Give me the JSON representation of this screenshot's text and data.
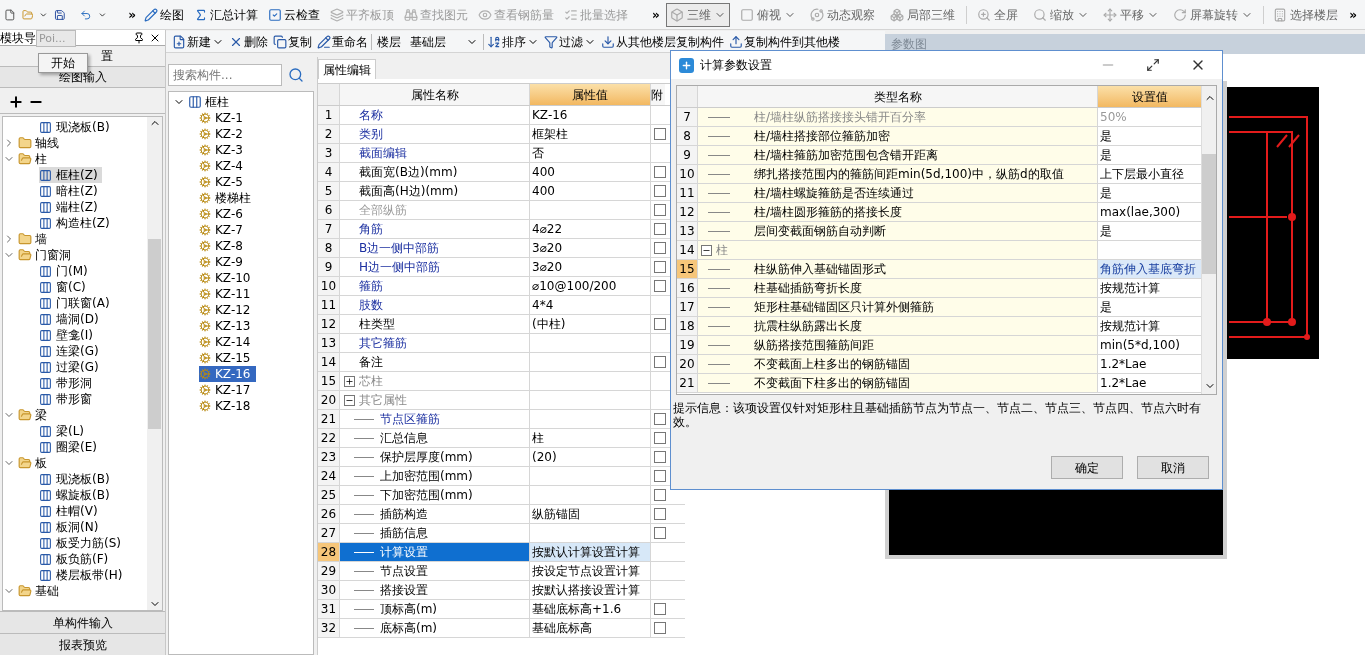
{
  "toolbar": {
    "overflow_marks": [
      "»",
      "»",
      "»"
    ],
    "left_items": [
      {
        "label": "绘图",
        "disabled": false
      },
      {
        "label": "汇总计算",
        "disabled": false
      },
      {
        "label": "云检查",
        "disabled": false
      },
      {
        "label": "平齐板顶",
        "disabled": true
      },
      {
        "label": "查找图元",
        "disabled": true
      },
      {
        "label": "查看钢筋量",
        "disabled": true
      },
      {
        "label": "批量选择",
        "disabled": true
      }
    ],
    "right_items": [
      {
        "label": "三维",
        "dropdown": true,
        "selected": true
      },
      {
        "label": "俯视",
        "dropdown": true,
        "selected": false
      },
      {
        "label": "动态观察",
        "dropdown": false,
        "selected": false
      },
      {
        "label": "局部三维",
        "dropdown": false,
        "selected": false
      },
      {
        "label": "全屏",
        "dropdown": false,
        "selected": false
      },
      {
        "label": "缩放",
        "dropdown": true,
        "selected": false
      },
      {
        "label": "平移",
        "dropdown": true,
        "selected": false
      },
      {
        "label": "屏幕旋转",
        "dropdown": true,
        "selected": false
      },
      {
        "label": "选择楼层",
        "dropdown": false,
        "selected": false
      }
    ]
  },
  "left_panel": {
    "title": "模块导",
    "popup_tab": "Poi...",
    "popup_menu_item": "开始",
    "top_sections": [
      "置",
      "绘图输入"
    ],
    "bottom_sections": [
      "单构件输入",
      "报表预览"
    ]
  },
  "module_tree": {
    "continued_items": [
      {
        "label": "现浇板(B)",
        "selected": false
      }
    ],
    "folders": [
      {
        "label": "轴线",
        "expanded": false
      },
      {
        "label": "柱",
        "expanded": true,
        "children": [
          {
            "label": "框柱(Z)",
            "selected": true
          },
          {
            "label": "暗柱(Z)",
            "selected": false
          },
          {
            "label": "端柱(Z)",
            "selected": false
          },
          {
            "label": "构造柱(Z)",
            "selected": false
          }
        ]
      },
      {
        "label": "墙",
        "expanded": false
      },
      {
        "label": "门窗洞",
        "expanded": true,
        "children": [
          {
            "label": "门(M)",
            "selected": false
          },
          {
            "label": "窗(C)",
            "selected": false
          },
          {
            "label": "门联窗(A)",
            "selected": false
          },
          {
            "label": "墙洞(D)",
            "selected": false
          },
          {
            "label": "壁龛(I)",
            "selected": false
          },
          {
            "label": "连梁(G)",
            "selected": false
          },
          {
            "label": "过梁(G)",
            "selected": false
          },
          {
            "label": "带形洞",
            "selected": false
          },
          {
            "label": "带形窗",
            "selected": false
          }
        ]
      },
      {
        "label": "梁",
        "expanded": true,
        "children": [
          {
            "label": "梁(L)",
            "selected": false
          },
          {
            "label": "圈梁(E)",
            "selected": false
          }
        ]
      },
      {
        "label": "板",
        "expanded": true,
        "children": [
          {
            "label": "现浇板(B)",
            "selected": false
          },
          {
            "label": "螺旋板(B)",
            "selected": false
          },
          {
            "label": "柱帽(V)",
            "selected": false
          },
          {
            "label": "板洞(N)",
            "selected": false
          },
          {
            "label": "板受力筋(S)",
            "selected": false
          },
          {
            "label": "板负筋(F)",
            "selected": false
          },
          {
            "label": "楼层板带(H)",
            "selected": false
          }
        ]
      },
      {
        "label": "基础",
        "expanded": true
      }
    ]
  },
  "component_toolbar": {
    "items_before": [
      {
        "label": "新建",
        "dropdown": true
      },
      {
        "label": "删除",
        "dropdown": false
      },
      {
        "label": "复制",
        "dropdown": false
      },
      {
        "label": "重命名",
        "dropdown": false
      }
    ],
    "floor_label": "楼层",
    "floor_value": "基础层",
    "items_after": [
      {
        "label": "排序",
        "dropdown": true
      },
      {
        "label": "过滤",
        "dropdown": true
      },
      {
        "label": "从其他楼层复制构件",
        "dropdown": false
      },
      {
        "label": "复制构件到其他楼",
        "dropdown": false
      }
    ]
  },
  "search": {
    "placeholder": "搜索构件..."
  },
  "component_tree": {
    "label": "框柱",
    "expanded": true,
    "children": [
      {
        "label": "KZ-1",
        "selected": false
      },
      {
        "label": "KZ-2",
        "selected": false
      },
      {
        "label": "KZ-3",
        "selected": false
      },
      {
        "label": "KZ-4",
        "selected": false
      },
      {
        "label": "KZ-5",
        "selected": false
      },
      {
        "label": "楼梯柱",
        "selected": false
      },
      {
        "label": "KZ-6",
        "selected": false
      },
      {
        "label": "KZ-7",
        "selected": false
      },
      {
        "label": "KZ-8",
        "selected": false
      },
      {
        "label": "KZ-9",
        "selected": false
      },
      {
        "label": "KZ-10",
        "selected": false
      },
      {
        "label": "KZ-11",
        "selected": false
      },
      {
        "label": "KZ-12",
        "selected": false
      },
      {
        "label": "KZ-13",
        "selected": false
      },
      {
        "label": "KZ-14",
        "selected": false
      },
      {
        "label": "KZ-15",
        "selected": false
      },
      {
        "label": "KZ-16",
        "selected": true
      },
      {
        "label": "KZ-17",
        "selected": false
      },
      {
        "label": "KZ-18",
        "selected": false
      }
    ]
  },
  "property_panel": {
    "tab": "属性编辑",
    "columns": [
      "属性名称",
      "属性值",
      "附"
    ],
    "rows": [
      {
        "number": "1",
        "name": "名称",
        "value": "KZ-16",
        "kind": "public",
        "selected": false
      },
      {
        "number": "2",
        "name": "类别",
        "value": "框架柱",
        "kind": "public",
        "selected": false,
        "checked": false
      },
      {
        "number": "3",
        "name": "截面编辑",
        "value": "否",
        "kind": "public",
        "selected": false
      },
      {
        "number": "4",
        "name": "截面宽(B边)(mm)",
        "value": "400",
        "kind": "private",
        "selected": false,
        "checked": false
      },
      {
        "number": "5",
        "name": "截面高(H边)(mm)",
        "value": "400",
        "kind": "private",
        "selected": false,
        "checked": false
      },
      {
        "number": "6",
        "name": "全部纵筋",
        "kind": "inactive",
        "selected": false,
        "checked": false
      },
      {
        "number": "7",
        "name": "角筋",
        "value": "4⌀22",
        "kind": "public",
        "selected": false,
        "checked": false
      },
      {
        "number": "8",
        "name": "B边一侧中部筋",
        "value": "3⌀20",
        "kind": "public",
        "selected": false,
        "checked": false
      },
      {
        "number": "9",
        "name": "H边一侧中部筋",
        "value": "3⌀20",
        "kind": "public",
        "selected": false,
        "checked": false
      },
      {
        "number": "10",
        "name": "箍筋",
        "value": "⌀10@100/200",
        "kind": "public",
        "selected": false,
        "checked": false
      },
      {
        "number": "11",
        "name": "肢数",
        "value": "4*4",
        "kind": "public",
        "selected": false
      },
      {
        "number": "12",
        "name": "柱类型",
        "value": "(中柱)",
        "kind": "private",
        "selected": false,
        "checked": false
      },
      {
        "number": "13",
        "name": "其它箍筋",
        "kind": "public",
        "selected": false
      },
      {
        "number": "14",
        "name": "备注",
        "kind": "private",
        "selected": false,
        "checked": false
      },
      {
        "number": "15",
        "name": "芯柱",
        "kind": "group",
        "expanded": false,
        "selected": false
      },
      {
        "number": "20",
        "name": "其它属性",
        "kind": "group",
        "expanded": true,
        "selected": false,
        "children": [
          {
            "number": "21",
            "name": "节点区箍筋",
            "kind": "public",
            "selected": false,
            "checked": false
          },
          {
            "number": "22",
            "name": "汇总信息",
            "value": "柱",
            "kind": "private",
            "selected": false,
            "checked": false
          },
          {
            "number": "23",
            "name": "保护层厚度(mm)",
            "value": "(20)",
            "kind": "private",
            "selected": false,
            "checked": false
          },
          {
            "number": "24",
            "name": "上加密范围(mm)",
            "kind": "private",
            "selected": false,
            "checked": false
          },
          {
            "number": "25",
            "name": "下加密范围(mm)",
            "kind": "private",
            "selected": false,
            "checked": false
          },
          {
            "number": "26",
            "name": "插筋构造",
            "value": "纵筋锚固",
            "kind": "private",
            "selected": false,
            "checked": false
          },
          {
            "number": "27",
            "name": "插筋信息",
            "kind": "private",
            "selected": false,
            "checked": false
          },
          {
            "number": "28",
            "name": "计算设置",
            "value": "按默认计算设置计算",
            "kind": "private",
            "selected": true
          },
          {
            "number": "29",
            "name": "节点设置",
            "value": "按设定节点设置计算",
            "kind": "private",
            "selected": false
          },
          {
            "number": "30",
            "name": "搭接设置",
            "value": "按默认搭接设置计算",
            "kind": "private",
            "selected": false
          },
          {
            "number": "31",
            "name": "顶标高(m)",
            "value": "基础底标高+1.6",
            "kind": "private",
            "selected": false,
            "checked": false
          },
          {
            "number": "32",
            "name": "底标高(m)",
            "value": "基础底标高",
            "kind": "private",
            "selected": false,
            "checked": false
          }
        ]
      }
    ]
  },
  "figure_panel": {
    "title": "参数图"
  },
  "dialog": {
    "title": "计算参数设置",
    "columns": [
      "类型名称",
      "设置值"
    ],
    "rows": [
      {
        "number": "7",
        "name": "柱/墙柱纵筋搭接接头错开百分率",
        "value": "50%",
        "kind": "item",
        "disabled": true,
        "selected": false
      },
      {
        "number": "8",
        "name": "柱/墙柱搭接部位箍筋加密",
        "value": "是",
        "kind": "item",
        "disabled": false,
        "selected": false
      },
      {
        "number": "9",
        "name": "柱/墙柱箍筋加密范围包含错开距离",
        "value": "是",
        "kind": "item",
        "disabled": false,
        "selected": false
      },
      {
        "number": "10",
        "name": "绑扎搭接范围内的箍筋间距min(5d,100)中，纵筋d的取值",
        "value": "上下层最小直径",
        "kind": "item",
        "disabled": false,
        "selected": false
      },
      {
        "number": "11",
        "name": "柱/墙柱螺旋箍筋是否连续通过",
        "value": "是",
        "kind": "item",
        "disabled": false,
        "selected": false
      },
      {
        "number": "12",
        "name": "柱/墙柱圆形箍筋的搭接长度",
        "value": "max(lae,300)",
        "kind": "item",
        "disabled": false,
        "selected": false
      },
      {
        "number": "13",
        "name": "层间变截面钢筋自动判断",
        "value": "是",
        "kind": "item",
        "disabled": false,
        "selected": false
      },
      {
        "number": "14",
        "name": "柱",
        "kind": "group",
        "expanded": true,
        "selected": false,
        "children": [
          {
            "number": "15",
            "name": "柱纵筋伸入基础锚固形式",
            "value": "角筋伸入基底弯折",
            "kind": "item",
            "disabled": false,
            "selected": true
          },
          {
            "number": "16",
            "name": "柱基础插筋弯折长度",
            "value": "按规范计算",
            "kind": "item",
            "disabled": false,
            "selected": false
          },
          {
            "number": "17",
            "name": "矩形柱基础锚固区只计算外侧箍筋",
            "value": "是",
            "kind": "item",
            "disabled": false,
            "selected": false
          },
          {
            "number": "18",
            "name": "抗震柱纵筋露出长度",
            "value": "按规范计算",
            "kind": "item",
            "disabled": false,
            "selected": false
          },
          {
            "number": "19",
            "name": "纵筋搭接范围箍筋间距",
            "value": "min(5*d,100)",
            "kind": "item",
            "disabled": false,
            "selected": false
          },
          {
            "number": "20",
            "name": "不变截面上柱多出的钢筋锚固",
            "value": "1.2*Lae",
            "kind": "item",
            "disabled": false,
            "selected": false
          },
          {
            "number": "21",
            "name": "不变截面下柱多出的钢筋锚固",
            "value": "1.2*Lae",
            "kind": "item",
            "disabled": false,
            "selected": false
          }
        ]
      }
    ],
    "info": "提示信息：该项设置仅针对矩形柱且基础插筋节点为节点一、节点二、节点三、节点四、节点六时有效。",
    "buttons": [
      "确定",
      "取消"
    ]
  }
}
